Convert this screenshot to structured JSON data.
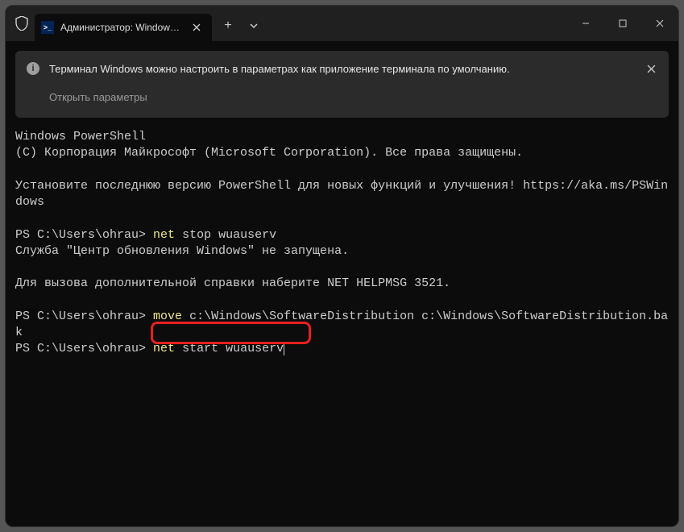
{
  "titlebar": {
    "tab_title": "Администратор: Windows Pc"
  },
  "infobar": {
    "message": "Терминал Windows можно настроить в параметрах как приложение терминала по умолчанию.",
    "open_settings": "Открыть параметры"
  },
  "terminal": {
    "header1": "Windows PowerShell",
    "header2": "(С) Корпорация Майкрософт (Microsoft Corporation). Все права защищены.",
    "install_msg": "Установите последнюю версию PowerShell для новых функций и улучшения! https://aka.ms/PSWindows",
    "prompt": "PS C:\\Users\\ohrau>",
    "cmd1_kw": "net",
    "cmd1_rest": " stop wuauserv",
    "out1": "Служба \"Центр обновления Windows\" не запущена.",
    "out2": "Для вызова дополнительной справки наберите NET HELPMSG 3521.",
    "cmd2_kw": "move",
    "cmd2_rest": " c:\\Windows\\SoftwareDistribution c:\\Windows\\SoftwareDistribution.bak",
    "cmd3_kw": "net",
    "cmd3_rest": " start wuauserv"
  }
}
